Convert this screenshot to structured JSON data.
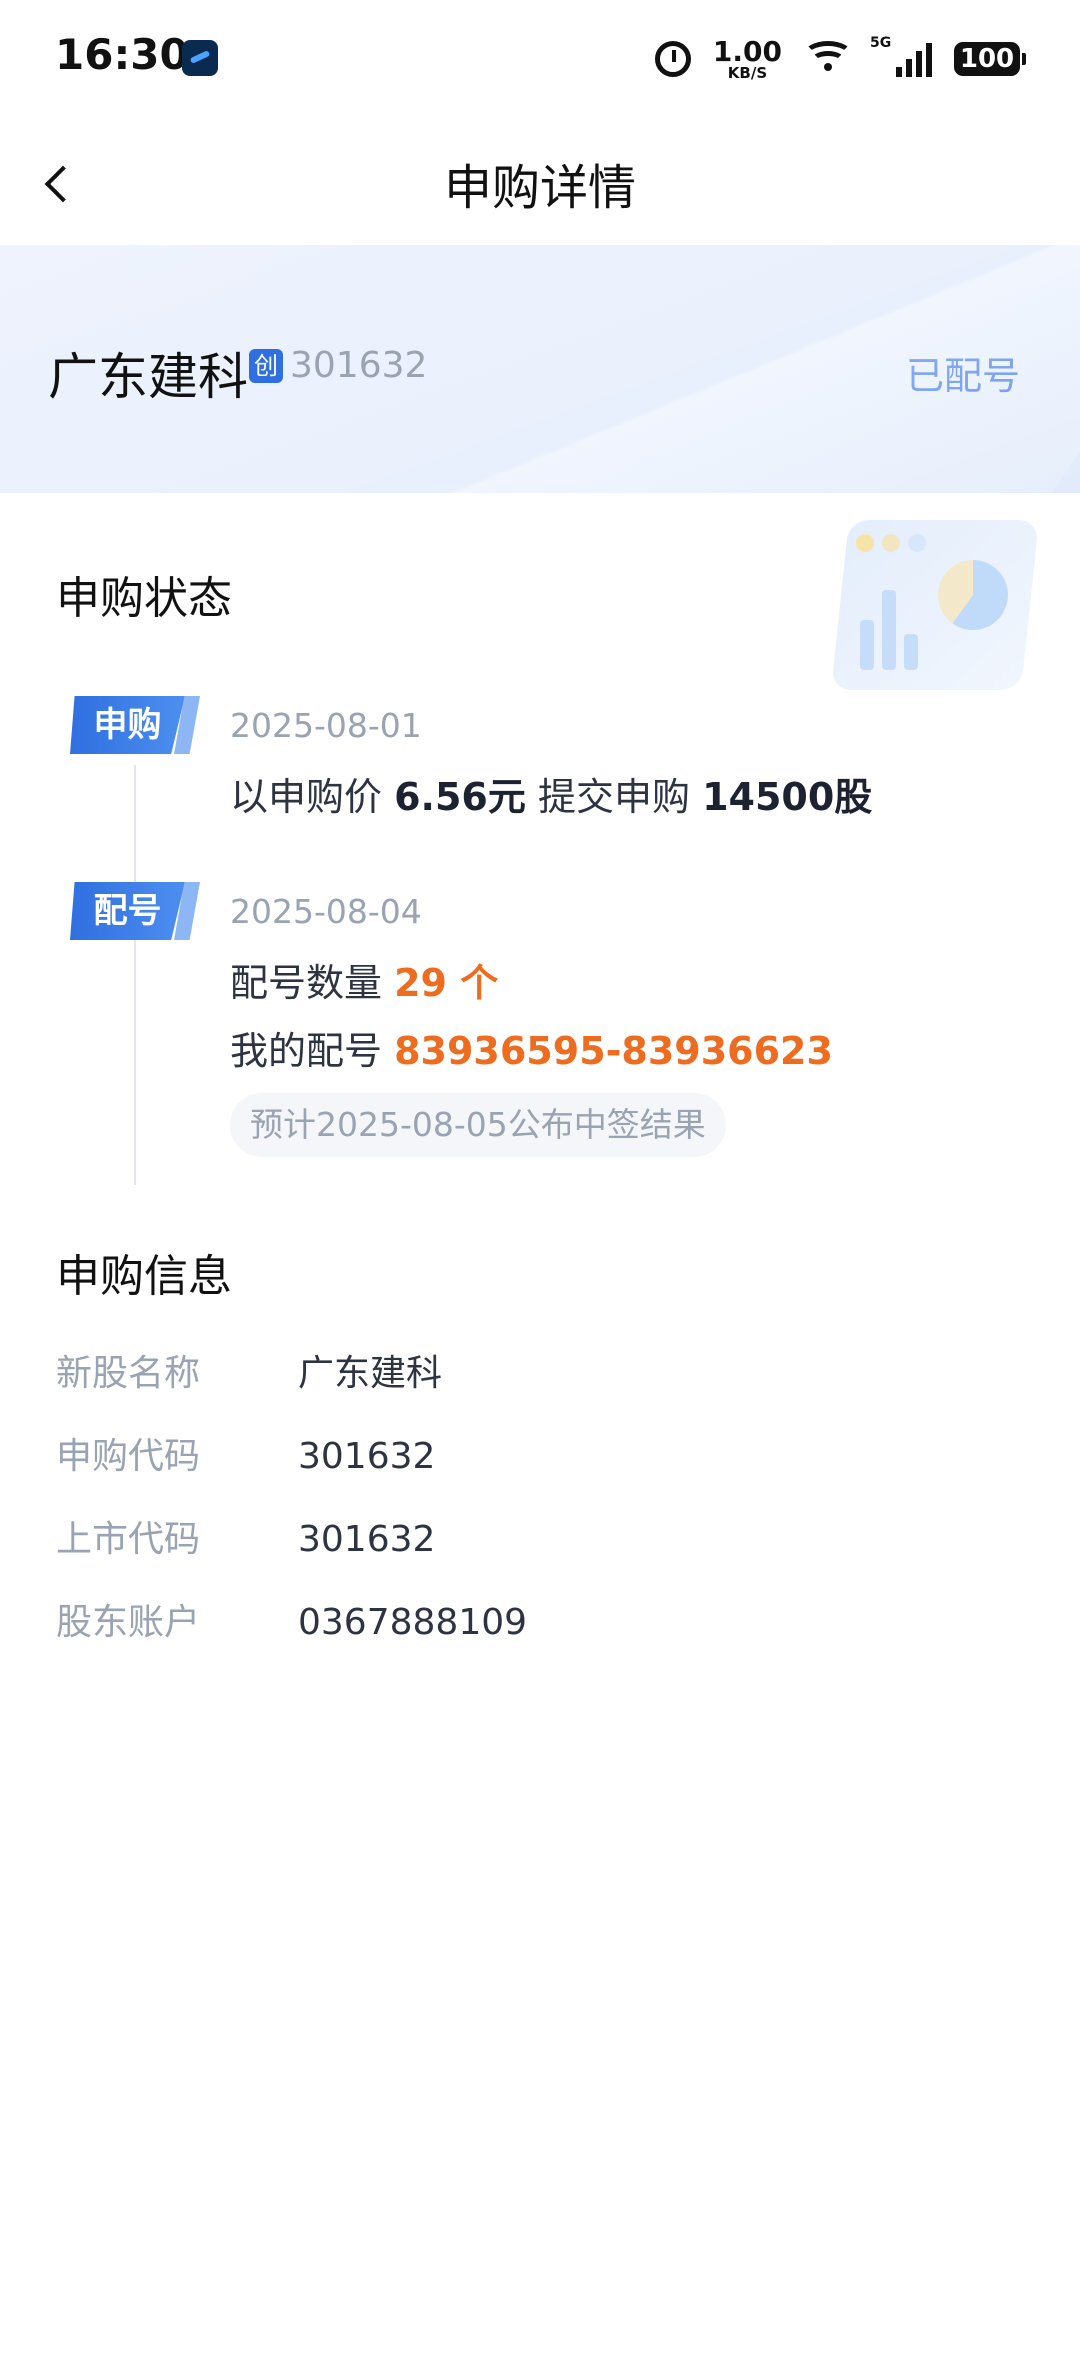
{
  "status_bar": {
    "time": "16:30",
    "net_speed": "1.00",
    "net_unit": "KB/S",
    "signal_label": "5G",
    "battery": "100"
  },
  "nav": {
    "title": "申购详情"
  },
  "stock": {
    "name": "广东建科",
    "board_badge": "创",
    "code": "301632",
    "status": "已配号"
  },
  "subscription_status": {
    "title": "申购状态",
    "steps": [
      {
        "tag": "申购",
        "date": "2025-08-01",
        "text_prefix": "以申购价",
        "price": "6.56元",
        "text_mid": "提交申购",
        "quantity": "14500股"
      },
      {
        "tag": "配号",
        "date": "2025-08-04",
        "count_label": "配号数量",
        "count_value": "29 个",
        "my_numbers_label": "我的配号",
        "my_numbers_value": "83936595-83936623",
        "notice": "预计2025-08-05公布中签结果"
      }
    ]
  },
  "subscription_info": {
    "title": "申购信息",
    "rows": [
      {
        "label": "新股名称",
        "value": "广东建科"
      },
      {
        "label": "申购代码",
        "value": "301632"
      },
      {
        "label": "上市代码",
        "value": "301632"
      },
      {
        "label": "股东账户",
        "value": "0367888109"
      }
    ]
  },
  "colors": {
    "accent_blue": "#2f6fe0",
    "highlight_orange": "#ee6c1f",
    "muted_text": "#9aa3b1"
  }
}
